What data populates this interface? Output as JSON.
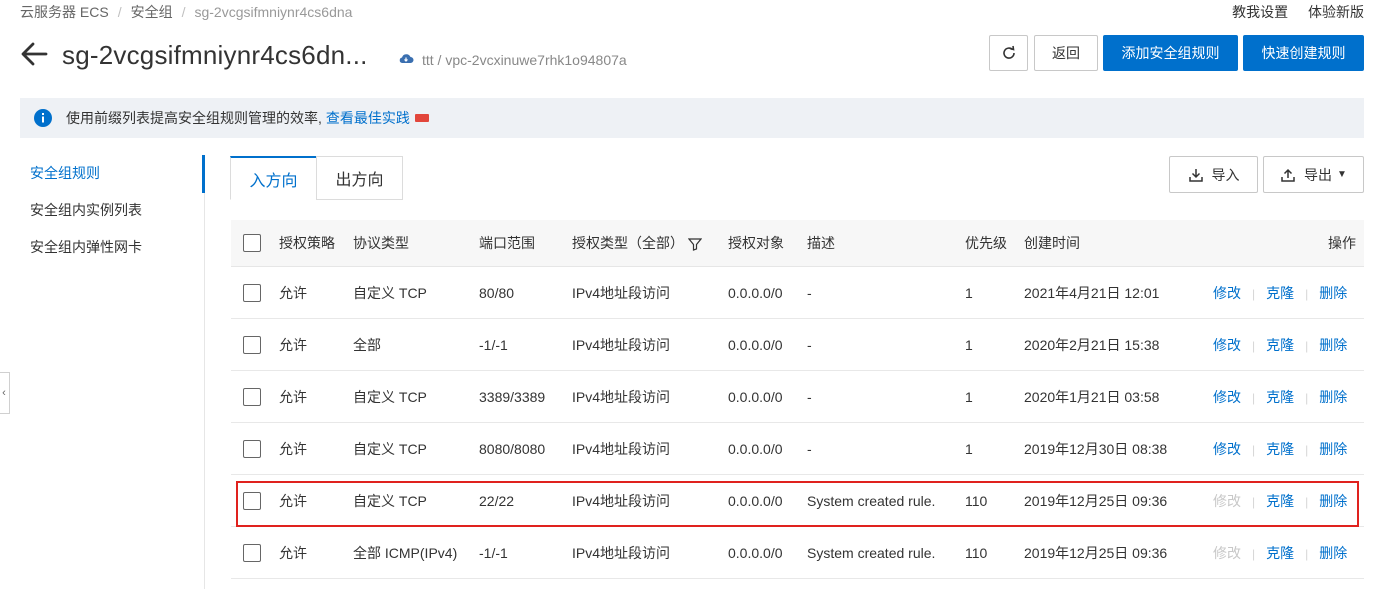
{
  "breadcrumb": [
    "云服务器 ECS",
    "安全组",
    "sg-2vcgsifmniynr4cs6dna"
  ],
  "top_links": [
    "教我设置",
    "体验新版"
  ],
  "header": {
    "title": "sg-2vcgsifmniynr4cs6dn...",
    "vpc_info": "ttt / vpc-2vcxinuwe7rhk1o94807a",
    "back_label": "返回",
    "add_rule_label": "添加安全组规则",
    "quick_create_label": "快速创建规则"
  },
  "notice": {
    "text": "使用前缀列表提高安全组规则管理的效率,",
    "link": "查看最佳实践"
  },
  "sidenav": {
    "items": [
      {
        "label": "安全组规则"
      },
      {
        "label": "安全组内实例列表"
      },
      {
        "label": "安全组内弹性网卡"
      }
    ]
  },
  "tabs": [
    {
      "label": "入方向"
    },
    {
      "label": "出方向"
    }
  ],
  "toolbar": {
    "import_label": "导入",
    "export_label": "导出"
  },
  "table": {
    "headers": {
      "policy": "授权策略",
      "protocol": "协议类型",
      "port": "端口范围",
      "auth_type": "授权类型（全部）",
      "object": "授权对象",
      "desc": "描述",
      "priority": "优先级",
      "created": "创建时间",
      "ops": "操作"
    },
    "rows": [
      {
        "policy": "允许",
        "protocol": "自定义 TCP",
        "port": "80/80",
        "auth_type": "IPv4地址段访问",
        "object": "0.0.0.0/0",
        "desc": "-",
        "priority": "1",
        "created": "2021年4月21日 12:01",
        "edit": "修改",
        "clone": "克隆",
        "delete": "删除"
      },
      {
        "policy": "允许",
        "protocol": "全部",
        "port": "-1/-1",
        "auth_type": "IPv4地址段访问",
        "object": "0.0.0.0/0",
        "desc": "-",
        "priority": "1",
        "created": "2020年2月21日 15:38",
        "edit": "修改",
        "clone": "克隆",
        "delete": "删除"
      },
      {
        "policy": "允许",
        "protocol": "自定义 TCP",
        "port": "3389/3389",
        "auth_type": "IPv4地址段访问",
        "object": "0.0.0.0/0",
        "desc": "-",
        "priority": "1",
        "created": "2020年1月21日 03:58",
        "edit": "修改",
        "clone": "克隆",
        "delete": "删除"
      },
      {
        "policy": "允许",
        "protocol": "自定义 TCP",
        "port": "8080/8080",
        "auth_type": "IPv4地址段访问",
        "object": "0.0.0.0/0",
        "desc": "-",
        "priority": "1",
        "created": "2019年12月30日 08:38",
        "edit": "修改",
        "clone": "克隆",
        "delete": "删除"
      },
      {
        "policy": "允许",
        "protocol": "自定义 TCP",
        "port": "22/22",
        "auth_type": "IPv4地址段访问",
        "object": "0.0.0.0/0",
        "desc": "System created rule.",
        "priority": "110",
        "created": "2019年12月25日 09:36",
        "edit": "修改",
        "clone": "克隆",
        "delete": "删除"
      },
      {
        "policy": "允许",
        "protocol": "全部 ICMP(IPv4)",
        "port": "-1/-1",
        "auth_type": "IPv4地址段访问",
        "object": "0.0.0.0/0",
        "desc": "System created rule.",
        "priority": "110",
        "created": "2019年12月25日 09:36",
        "edit": "修改",
        "clone": "克隆",
        "delete": "删除"
      }
    ]
  },
  "colors": {
    "accent": "#0070cc",
    "highlight": "#e0221e"
  }
}
